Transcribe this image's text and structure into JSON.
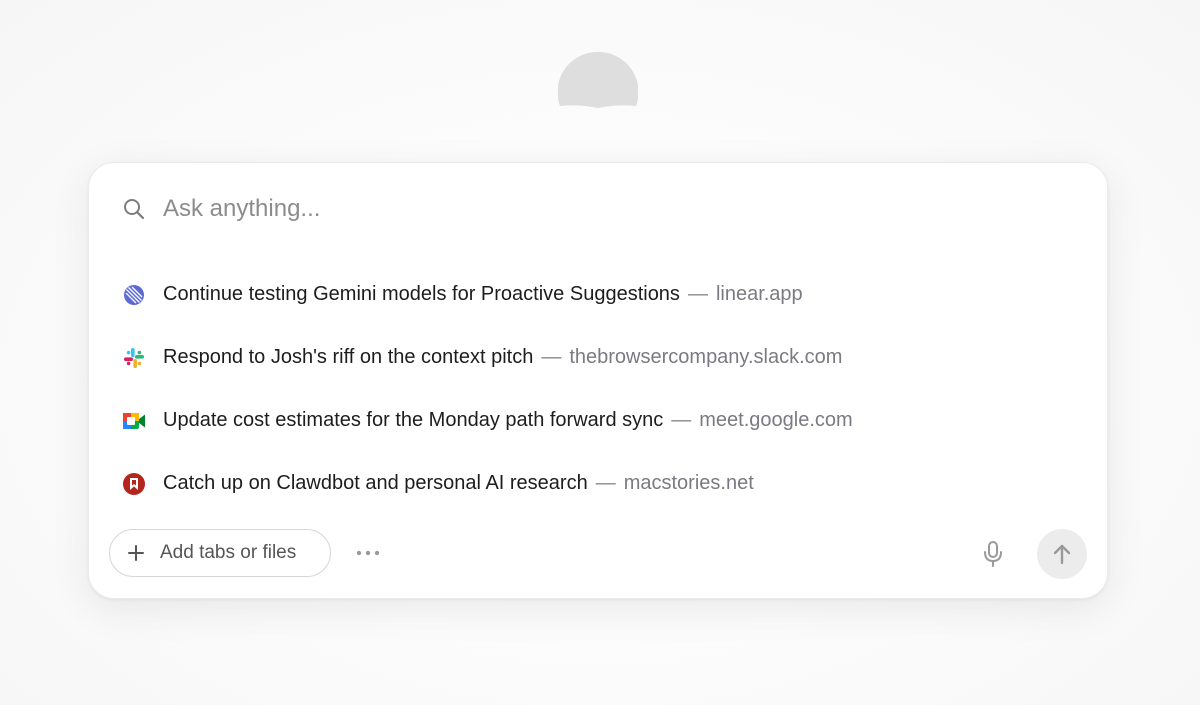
{
  "search": {
    "placeholder": "Ask anything..."
  },
  "suggestions": [
    {
      "title": "Continue testing Gemini models for Proactive Suggestions",
      "separator": "—",
      "domain": "linear.app",
      "icon": "linear-icon"
    },
    {
      "title": "Respond to Josh's riff on the context pitch",
      "separator": "—",
      "domain": "thebrowsercompany.slack.com",
      "icon": "slack-icon"
    },
    {
      "title": "Update cost estimates for the Monday path forward sync",
      "separator": "—",
      "domain": "meet.google.com",
      "icon": "google-meet-icon"
    },
    {
      "title": "Catch up on Clawdbot and personal AI research",
      "separator": "—",
      "domain": "macstories.net",
      "icon": "macstories-icon"
    }
  ],
  "toolbar": {
    "add_label": "Add tabs or files",
    "add_icon": "plus-icon",
    "more_icon": "more-icon",
    "mic_icon": "microphone-icon",
    "send_icon": "arrow-up-icon"
  },
  "colors": {
    "linear": "#5e6ad2",
    "macstories": "#b3261e",
    "send_bg": "#ececec"
  }
}
